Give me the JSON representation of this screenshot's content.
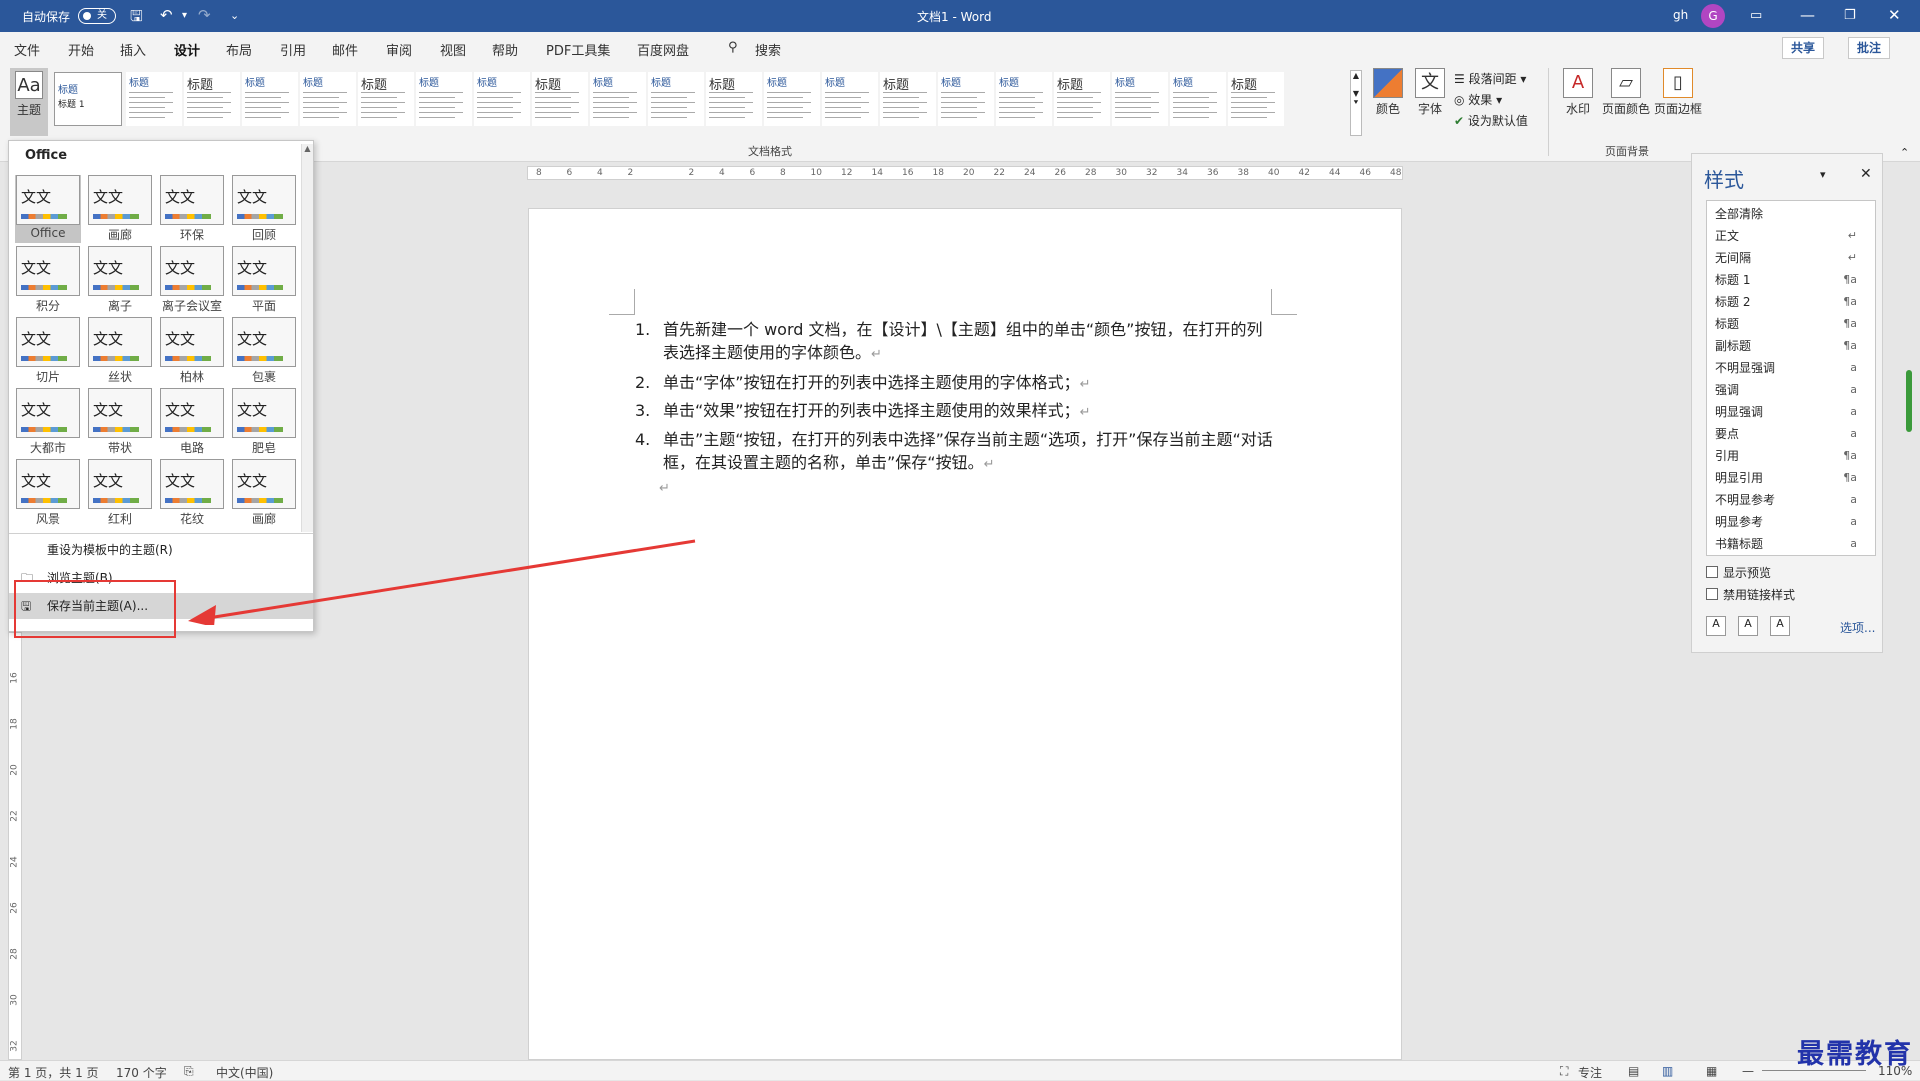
{
  "titlebar": {
    "autosave_label": "自动保存",
    "autosave_state": "关",
    "title": "文档1 - Word",
    "user": "gh",
    "avatar_letter": "G"
  },
  "tabs": [
    "文件",
    "开始",
    "插入",
    "设计",
    "布局",
    "引用",
    "邮件",
    "审阅",
    "视图",
    "帮助",
    "PDF工具集",
    "百度网盘"
  ],
  "active_tab": "设计",
  "search_label": "搜索",
  "share_label": "共享",
  "comment_label": "批注",
  "ribbon": {
    "theme_button": "主题",
    "style_thumb_heading": "标题",
    "style_thumb_heading1": "标题 1",
    "group_doc_format": "文档格式",
    "colors": "颜色",
    "fonts": "字体",
    "paragraph_spacing": "段落间距",
    "effects": "效果",
    "set_default": "设为默认值",
    "watermark": "水印",
    "page_color": "页面颜色",
    "page_border": "页面边框",
    "group_page_bg": "页面背景"
  },
  "theme_panel": {
    "title": "Office",
    "themes": [
      "Office",
      "画廊",
      "环保",
      "回顾",
      "积分",
      "离子",
      "离子会议室",
      "平面",
      "切片",
      "丝状",
      "柏林",
      "包裹",
      "大都市",
      "带状",
      "电路",
      "肥皂",
      "风景",
      "红利",
      "花纹",
      "画廊"
    ],
    "selected": "Office",
    "menu": [
      "重设为模板中的主题(R)",
      "浏览主题(B)...",
      "保存当前主题(A)..."
    ]
  },
  "document": {
    "items": [
      {
        "num": "1.",
        "text": "首先新建一个 word 文档，在【设计】\\【主题】组中的单击“颜色”按钮，在打开的列表选择主题使用的字体颜色。"
      },
      {
        "num": "2.",
        "text": "单击“字体”按钮在打开的列表中选择主题使用的字体格式；"
      },
      {
        "num": "3.",
        "text": "单击“效果”按钮在打开的列表中选择主题使用的效果样式；"
      },
      {
        "num": "4.",
        "text": "单击”主题“按钮，在打开的列表中选择”保存当前主题“选项，打开”保存当前主题“对话框，在其设置主题的名称，单击”保存“按钮。"
      }
    ],
    "para_mark": "↵"
  },
  "ruler_ticks": [
    "8",
    "6",
    "4",
    "2",
    "",
    "2",
    "4",
    "6",
    "8",
    "10",
    "12",
    "14",
    "16",
    "18",
    "20",
    "22",
    "24",
    "26",
    "28",
    "30",
    "32",
    "34",
    "36",
    "38",
    "40",
    "42",
    "44",
    "46",
    "48"
  ],
  "vruler_ticks": [
    "16",
    "18",
    "20",
    "22",
    "24",
    "26",
    "28",
    "30",
    "32"
  ],
  "styles_pane": {
    "title": "样式",
    "styles": [
      {
        "name": "全部清除",
        "sym": ""
      },
      {
        "name": "正文",
        "sym": "↵"
      },
      {
        "name": "无间隔",
        "sym": "↵"
      },
      {
        "name": "标题 1",
        "sym": "¶a"
      },
      {
        "name": "标题 2",
        "sym": "¶a"
      },
      {
        "name": "标题",
        "sym": "¶a"
      },
      {
        "name": "副标题",
        "sym": "¶a"
      },
      {
        "name": "不明显强调",
        "sym": "a"
      },
      {
        "name": "强调",
        "sym": "a"
      },
      {
        "name": "明显强调",
        "sym": "a"
      },
      {
        "name": "要点",
        "sym": "a"
      },
      {
        "name": "引用",
        "sym": "¶a"
      },
      {
        "name": "明显引用",
        "sym": "¶a"
      },
      {
        "name": "不明显参考",
        "sym": "a"
      },
      {
        "name": "明显参考",
        "sym": "a"
      },
      {
        "name": "书籍标题",
        "sym": "a"
      }
    ],
    "show_preview": "显示预览",
    "disable_linked": "禁用链接样式",
    "options": "选项..."
  },
  "status": {
    "page": "第 1 页，共 1 页",
    "words": "170 个字",
    "lang": "中文(中国)",
    "focus": "专注",
    "zoom": "110%"
  },
  "watermark_text": "最需教育",
  "colors": {
    "accent": "#2b579a",
    "annotation": "#e53935"
  }
}
